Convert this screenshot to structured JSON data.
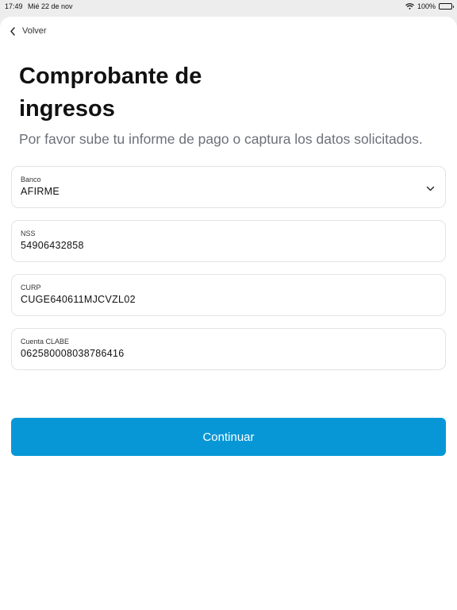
{
  "status_bar": {
    "time": "17:49",
    "date": "Mié 22 de nov",
    "battery": "100%"
  },
  "nav": {
    "back_label": "Volver"
  },
  "page": {
    "title": "Comprobante de ingresos",
    "subtitle": "Por favor sube tu informe de pago o captura los datos solicitados."
  },
  "form": {
    "banco": {
      "label": "Banco",
      "value": "AFIRME"
    },
    "nss": {
      "label": "NSS",
      "value": "54906432858"
    },
    "curp": {
      "label": "CURP",
      "value": "CUGE640611MJCVZL02"
    },
    "clabe": {
      "label": "Cuenta CLABE",
      "value": "062580008038786416"
    }
  },
  "actions": {
    "continue_label": "Continuar"
  },
  "colors": {
    "primary": "#0797d7",
    "subtitle": "#6d7178",
    "border": "#e3e3e3"
  }
}
